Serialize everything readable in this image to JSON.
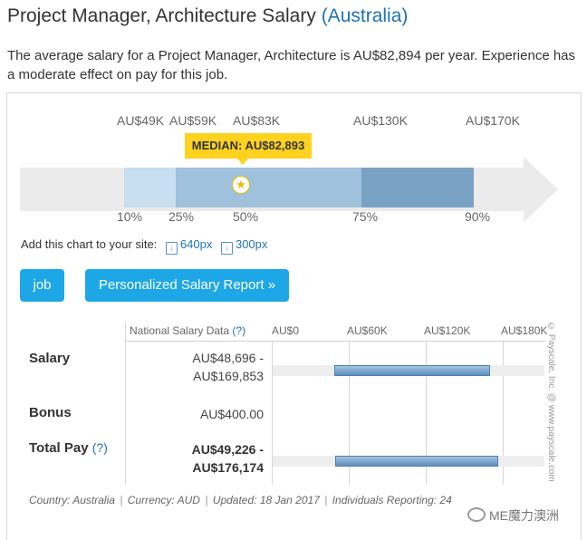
{
  "header": {
    "title": "Project Manager, Architecture Salary",
    "region": "(Australia)",
    "summary": "The average salary for a Project Manager, Architecture is AU$82,894 per year. Experience has a moderate effect on pay for this job."
  },
  "range_chart": {
    "top_labels": [
      "AU$49K",
      "AU$59K",
      "AU$83K",
      "AU$130K",
      "AU$170K"
    ],
    "percentiles": [
      "10%",
      "25%",
      "50%",
      "75%",
      "90%"
    ],
    "median_label": "MEDIAN: AU$82,893",
    "colors": {
      "p10_25": "#c7dff0",
      "p25_75": "#9fc1dc",
      "p75_90": "#7aa2c4",
      "arrow": "#ebebeb",
      "median": "#ffd21f"
    }
  },
  "add_chart": {
    "label": "Add this chart to your site:",
    "link_640": "640px",
    "link_300": "300px"
  },
  "buttons": {
    "job": "job",
    "report": "Personalized Salary Report »"
  },
  "table": {
    "header_label": "National Salary Data",
    "header_q": "(?)",
    "axis_labels": [
      "AU$0",
      "AU$60K",
      "AU$120K",
      "AU$180K"
    ],
    "rows": [
      {
        "label": "Salary",
        "q": "",
        "value_line1": "AU$48,696 -",
        "value_line2": "AU$169,853",
        "min": 48696,
        "max": 169853
      },
      {
        "label": "Bonus",
        "q": "",
        "value_line1": "AU$400.00",
        "value_line2": ""
      },
      {
        "label": "Total Pay",
        "q": "(?)",
        "value_line1": "AU$49,226 -",
        "value_line2": "AU$176,174",
        "min": 49226,
        "max": 176174
      }
    ],
    "axis_max": 180000
  },
  "footer": {
    "country": "Country: Australia",
    "currency": "Currency: AUD",
    "updated": "Updated: 18 Jan 2017",
    "reporting": "Individuals Reporting: 24"
  },
  "copyright": "© Payscale, Inc. @ www.payscale.com",
  "watermark": "ME魔力澳洲"
}
